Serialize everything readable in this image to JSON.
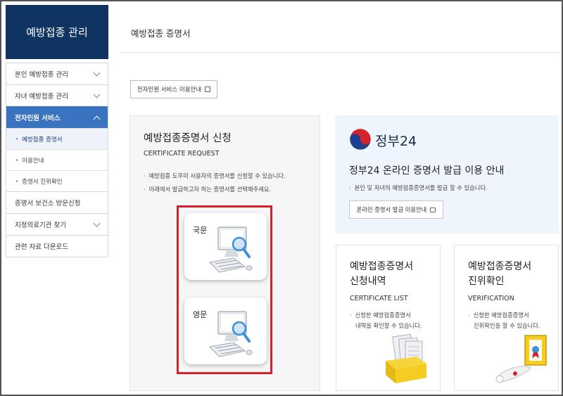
{
  "sidebar": {
    "title": "예방접종 관리",
    "menu": [
      {
        "label": "본인 예방접종 관리"
      },
      {
        "label": "자녀 예방접종 관리"
      },
      {
        "label": "전자민원 서비스"
      },
      {
        "label": "증명서 보건소 방문신청"
      },
      {
        "label": "지정의료기관 찾기"
      },
      {
        "label": "관련 자료 다운로드"
      }
    ],
    "submenu": [
      {
        "label": "예방접종 증명서"
      },
      {
        "label": "이용안내"
      },
      {
        "label": "증명서 진위확인"
      }
    ]
  },
  "page": {
    "title": "예방접종 증명서",
    "guide_button": "전자민원 서비스 이용안내"
  },
  "request": {
    "title": "예방접종증명서 신청",
    "subtitle": "CERTIFICATE REQUEST",
    "bullets": [
      "예방접종 도우미 사용자의 증명서를 신청할 수 있습니다.",
      "아래에서 발급하고자 하는 증명서를 선택해주세요."
    ],
    "korean_label": "국문",
    "english_label": "영문"
  },
  "gov24": {
    "brand": "정부24",
    "title": "정부24 온라인 증명서 발급 이용 안내",
    "bullet": "본인 및 자녀의 예방접종증명서를 발급 할 수 있습니다.",
    "button": "온라인 증명서 발급 이용안내"
  },
  "history": {
    "title_line1": "예방접종증명서",
    "title_line2": "신청내역",
    "subtitle": "CERTIFICATE LIST",
    "desc_line1": "신청한 예방접종증명서",
    "desc_line2": "내역을 확인할 수 있습니다."
  },
  "verify": {
    "title_line1": "예방접종증명서",
    "title_line2": "진위확인",
    "subtitle": "VERIFICATION",
    "desc_line1": "신청한 예방접종증명서",
    "desc_line2": "진위확인을 할 수 있습니다."
  },
  "colors": {
    "sidebar_header": "#0f3461",
    "active_menu": "#3a74c1",
    "highlight_box": "#d6202a"
  }
}
